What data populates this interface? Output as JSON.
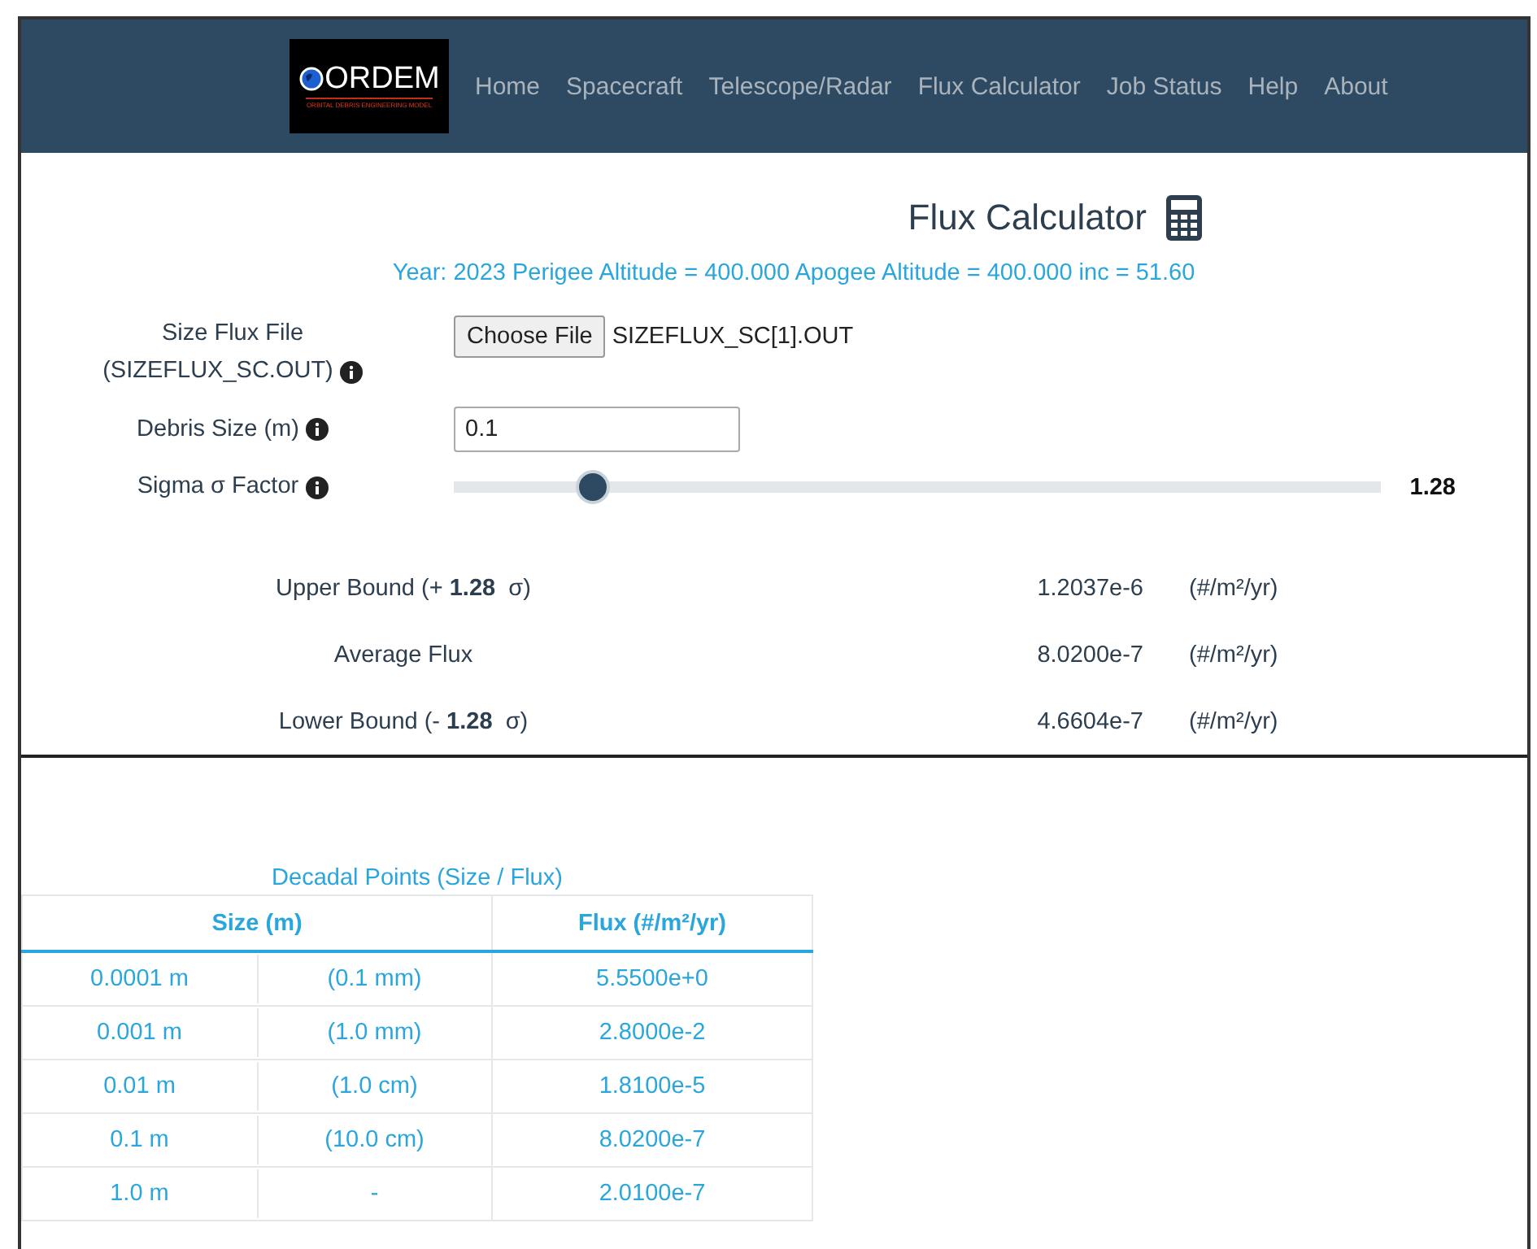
{
  "nav": {
    "logo": {
      "title": "ORDEM",
      "subtitle": "ORBITAL DEBRIS ENGINEERING MODEL"
    },
    "links": [
      {
        "label": "Home",
        "selected": false
      },
      {
        "label": "Spacecraft",
        "selected": false
      },
      {
        "label": "Telescope/Radar",
        "selected": false
      },
      {
        "label": "Flux Calculator",
        "selected": false
      },
      {
        "label": "Job Status",
        "selected": false
      },
      {
        "label": "Help",
        "selected": false
      },
      {
        "label": "About",
        "selected": false
      }
    ]
  },
  "heading": "Flux Calculator",
  "subtitle": "Year: 2023 Perigee Altitude = 400.000 Apogee Altitude = 400.000 inc = 51.60",
  "form": {
    "file_label_1": "Size Flux File",
    "file_label_2": "(SIZEFLUX_SC.OUT)",
    "file_button": "Choose File",
    "file_name": "SIZEFLUX_SC[1].OUT",
    "size_label": "Debris Size (m)",
    "size_value": "0.1",
    "sigma_label": "Sigma σ Factor",
    "sigma": {
      "level": 0.15,
      "reading": "1.28"
    }
  },
  "results": [
    {
      "label": "Upper Bound (+ **1.28**  σ)",
      "value": "1.2037e-6",
      "unit": "(#/m²/yr)"
    },
    {
      "label": "Average Flux",
      "value": "8.0200e-7",
      "unit": "(#/m²/yr)"
    },
    {
      "label": "Lower Bound (- **1.28**  σ)",
      "value": "4.6604e-7",
      "unit": "(#/m²/yr)"
    }
  ],
  "table": {
    "title": "Decadal Points (Size / Flux)",
    "columns": [
      "Size (m)",
      "Flux (#/m²/yr)"
    ],
    "rows": [
      {
        "size": "0.0001 m",
        "size_alt": "(0.1 mm)",
        "flux": "5.5500e+0"
      },
      {
        "size": "0.001 m",
        "size_alt": "(1.0 mm)",
        "flux": "2.8000e-2"
      },
      {
        "size": "0.01 m",
        "size_alt": "(1.0 cm)",
        "flux": "1.8100e-5"
      },
      {
        "size": "0.1 m",
        "size_alt": "(10.0 cm)",
        "flux": "8.0200e-7"
      },
      {
        "size": "1.0 m",
        "size_alt": "-",
        "flux": "2.0100e-7"
      }
    ]
  }
}
